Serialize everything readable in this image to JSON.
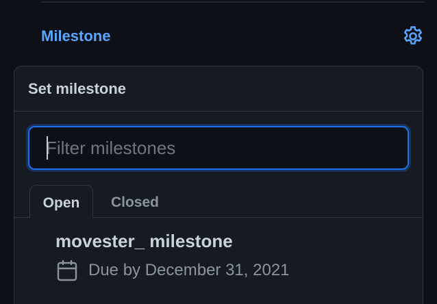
{
  "sidebar": {
    "milestone_heading": "Milestone",
    "settings_icon": "gear-icon"
  },
  "popover": {
    "title": "Set milestone",
    "filter": {
      "placeholder": "Filter milestones",
      "value": ""
    },
    "tabs": [
      {
        "label": "Open",
        "selected": true
      },
      {
        "label": "Closed",
        "selected": false
      }
    ],
    "milestones": [
      {
        "title": "movester_ milestone",
        "due": "Due by December 31, 2021",
        "icon": "calendar-icon"
      }
    ]
  },
  "colors": {
    "background": "#0d1117",
    "panel": "#161b22",
    "border": "#30363d",
    "accent": "#58a6ff",
    "focus_ring": "#1f6feb",
    "text_primary": "#c9d1d9",
    "text_muted": "#8b949e"
  }
}
